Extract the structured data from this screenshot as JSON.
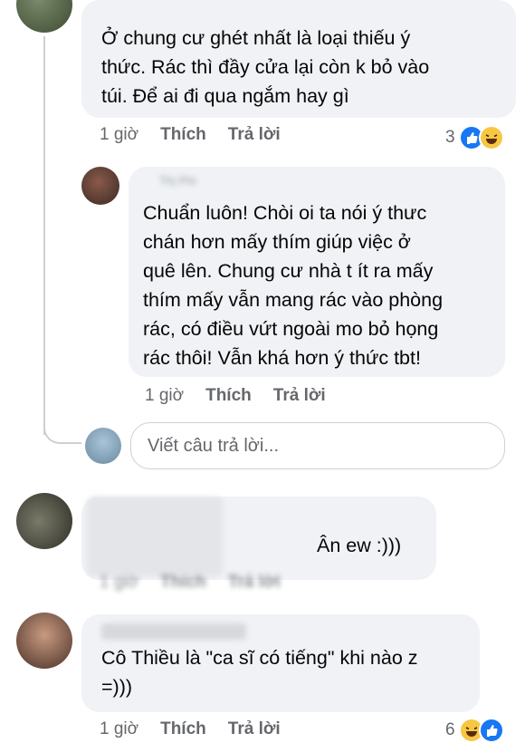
{
  "comments": [
    {
      "name": "",
      "text": "Ở chung cư ghét nhất là loại thiếu ý\nthức. Rác thì đầy cửa lại còn k bỏ vào\ntúi. Để ai đi qua ngắm hay gì",
      "time": "1 giờ",
      "like_label": "Thích",
      "reply_label": "Trả lời",
      "reaction_count": "3"
    },
    {
      "name": "Thị Phi",
      "text": "Chuẩn luôn! Chòi oi ta nói ý thưc\nchán hơn mấy thím giúp việc ở\nquê lên. Chung cư nhà t ít ra mấy\nthím mấy vẫn mang rác vào phòng\nrác, có điều vứt ngoài mo bỏ họng\nrác thôi! Vẫn khá hơn ý thức tbt!",
      "time": "1 giờ",
      "like_label": "Thích",
      "reply_label": "Trả lời"
    },
    {
      "name": "",
      "text": "Ân ew :)))",
      "time": "1 giờ",
      "like_label": "Thích",
      "reply_label": "Trả lời"
    },
    {
      "name": "",
      "text": "Cô Thiều là \"ca sĩ có tiếng\" khi nào z\n=)))",
      "time": "1 giờ",
      "like_label": "Thích",
      "reply_label": "Trả lời",
      "reaction_count": "6"
    }
  ],
  "reply_box": {
    "placeholder": "Viết câu trả lời..."
  },
  "colors": {
    "bubble": "#f0f2f5",
    "meta": "#65676b",
    "like": "#1877f2",
    "haha": "#f7c744"
  },
  "icons": [
    "like-icon",
    "haha-icon"
  ]
}
